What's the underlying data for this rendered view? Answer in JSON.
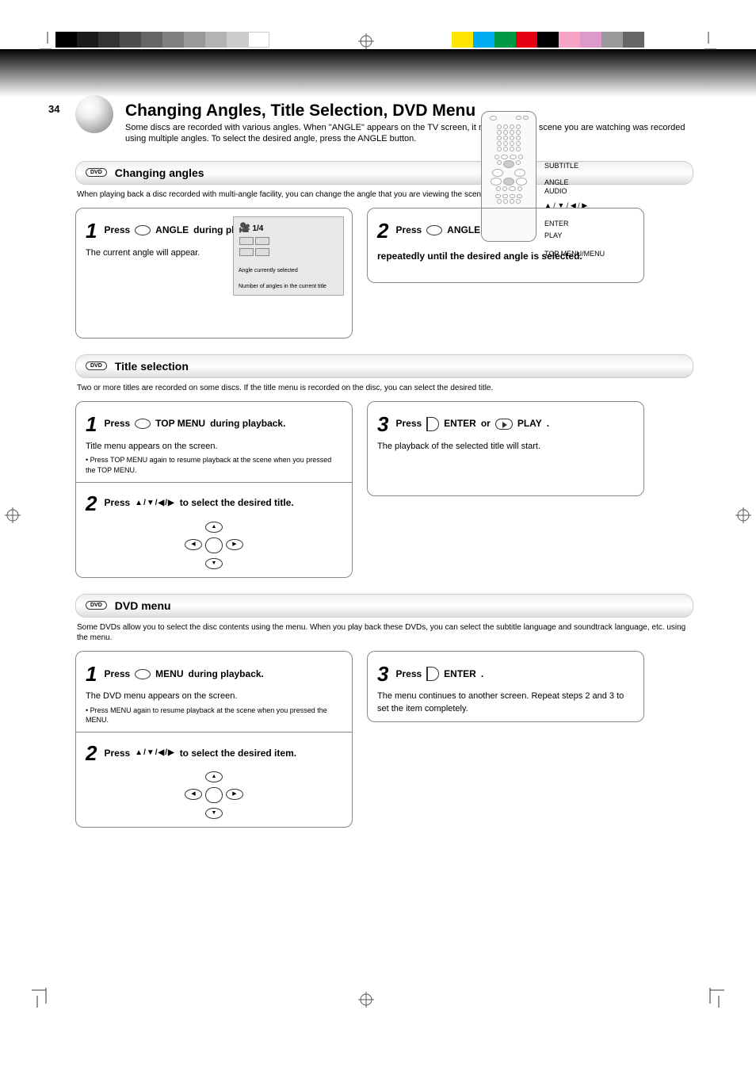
{
  "page_number": "34",
  "header": {
    "title": "Changing Angles, Title Selection, DVD Menu",
    "subtitle": "Some discs are recorded with various angles. When \"ANGLE\" appears on the TV screen, it means that the scene you are watching was recorded using multiple angles. To select the desired angle, press the ANGLE button."
  },
  "remote": {
    "labels": [
      "SUBTITLE",
      "ANGLE",
      "AUDIO",
      "▲ / ▼ / ◀ / ▶",
      "ENTER",
      "PLAY",
      "TOP MENU/MENU"
    ]
  },
  "sections": {
    "angle": {
      "title": "Changing angles",
      "desc": "When playing back a disc recorded with multi-angle facility, you can change the angle that you are viewing the scene from.",
      "step1": {
        "heading_pre": "Press",
        "heading_btn": "ANGLE",
        "heading_post": "during playback.",
        "body": "The current angle will appear.",
        "inset": {
          "cam": "🎥",
          "label": "1/4",
          "caption": "Number of angles in the current title",
          "caption2": "Angle currently selected"
        }
      },
      "step2": {
        "heading_pre": "Press",
        "heading_btn": "ANGLE",
        "heading_post": "repeatedly until the desired angle is selected."
      }
    },
    "title": {
      "title": "Title selection",
      "desc": "Two or more titles are recorded on some discs. If the title menu is recorded on the disc, you can select the desired title.",
      "step1": {
        "heading_pre": "Press",
        "heading_btn": "TOP MENU",
        "heading_post": "during playback.",
        "body": "Title menu appears on the screen.",
        "body2": "• Press TOP MENU again to resume playback at the scene when you pressed the TOP MENU."
      },
      "step2": {
        "heading_pre": "Press",
        "heading_arrows": "▲/▼/◀/▶",
        "heading_post": "to select the desired title."
      },
      "step3": {
        "heading_pre": "Press",
        "heading_btn": "ENTER",
        "heading_or": "or",
        "heading_btn2": "PLAY",
        "heading_post": ".",
        "body": "The playback of the selected title will start."
      }
    },
    "menu": {
      "title": "DVD menu",
      "desc": "Some DVDs allow you to select the disc contents using the menu. When you play back these DVDs, you can select the subtitle language and soundtrack language, etc. using the menu.",
      "step1": {
        "heading_pre": "Press",
        "heading_btn": "MENU",
        "heading_post": "during playback.",
        "body": "The DVD menu appears on the screen.",
        "body2": "• Press MENU again to resume playback at the scene when you pressed the MENU."
      },
      "step2": {
        "heading_pre": "Press",
        "heading_arrows": "▲/▼/◀/▶",
        "heading_post": "to select the desired item."
      },
      "step3": {
        "heading_pre": "Press",
        "heading_btn": "ENTER",
        "heading_post": ".",
        "body": "The menu continues to another screen. Repeat steps 2 and 3 to set the item completely."
      }
    }
  },
  "colors": {
    "grayscale": [
      "#000",
      "#222",
      "#333",
      "#555",
      "#777",
      "#999",
      "#bbb",
      "#ddd",
      "#eee",
      "#fff"
    ],
    "color_strip": [
      "#ffe600",
      "#00aeef",
      "#009944",
      "#e60012",
      "#333",
      "#f5a3c7",
      "#cde",
      "#999",
      "#666"
    ]
  }
}
